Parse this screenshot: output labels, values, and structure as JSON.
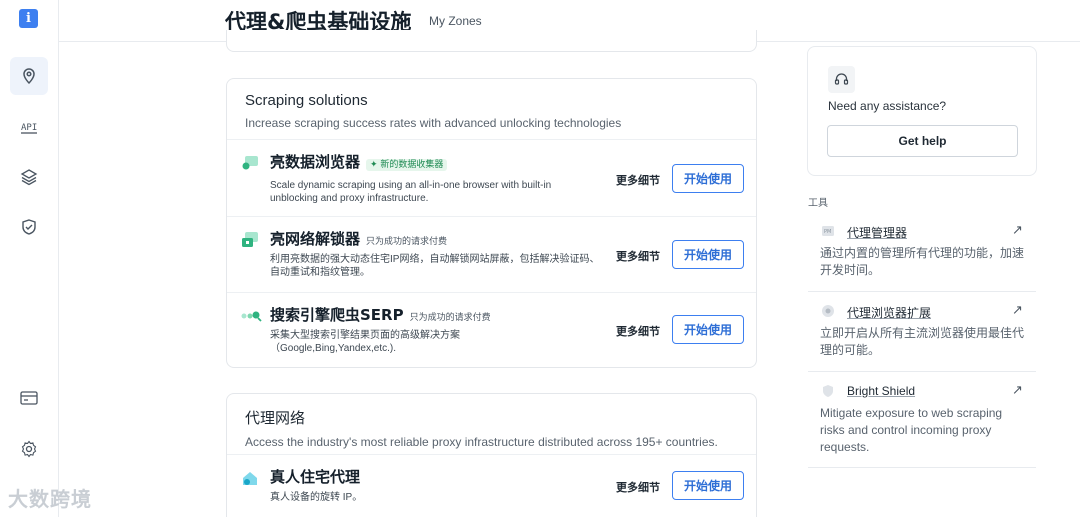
{
  "header": {
    "title": "代理&爬虫基础设施",
    "zones": "My Zones"
  },
  "rail": {
    "items": [
      "location-pin-icon",
      "api-icon",
      "layers-icon",
      "shield-icon",
      "billing-card-icon",
      "settings-gear-icon"
    ]
  },
  "scraping": {
    "title": "Scraping solutions",
    "subtitle": "Increase scraping success rates with advanced unlocking technologies",
    "products": [
      {
        "name": "亮数据浏览器",
        "tag": "✦ 新的数据收集器",
        "desc": "Scale dynamic scraping using an all-in-one browser with built-in unblocking and proxy infrastructure.",
        "more": "更多细节",
        "cta": "开始使用"
      },
      {
        "name": "亮网络解锁器",
        "tag": "只为成功的请求付费",
        "desc": "利用亮数据的强大动态住宅IP网络，自动解锁网站屏蔽，包括解决验证码、自动重试和指纹管理。",
        "more": "更多细节",
        "cta": "开始使用"
      },
      {
        "name": "搜索引擎爬虫SERP",
        "tag": "只为成功的请求付费",
        "desc": "采集大型搜索引擎结果页面的高级解决方案（Google,Bing,Yandex,etc.).",
        "more": "更多细节",
        "cta": "开始使用"
      }
    ]
  },
  "proxy": {
    "title": "代理网络",
    "subtitle": "Access the industry's most reliable proxy infrastructure distributed across 195+ countries.",
    "products": [
      {
        "name": "真人住宅代理",
        "desc": "真人设备的旋转 IP。",
        "more": "更多细节",
        "cta": "开始使用"
      }
    ]
  },
  "help": {
    "question": "Need any assistance?",
    "button": "Get help"
  },
  "tools": {
    "label": "工具",
    "items": [
      {
        "name": "代理管理器",
        "desc": "通过内置的管理所有代理的功能，加速开发时间。"
      },
      {
        "name": "代理浏览器扩展",
        "desc": "立即开启从所有主流浏览器使用最佳代理的可能。"
      },
      {
        "name": "Bright Shield",
        "desc": "Mitigate exposure to web scraping risks and control incoming proxy requests."
      }
    ]
  },
  "watermark": "大数跨境"
}
